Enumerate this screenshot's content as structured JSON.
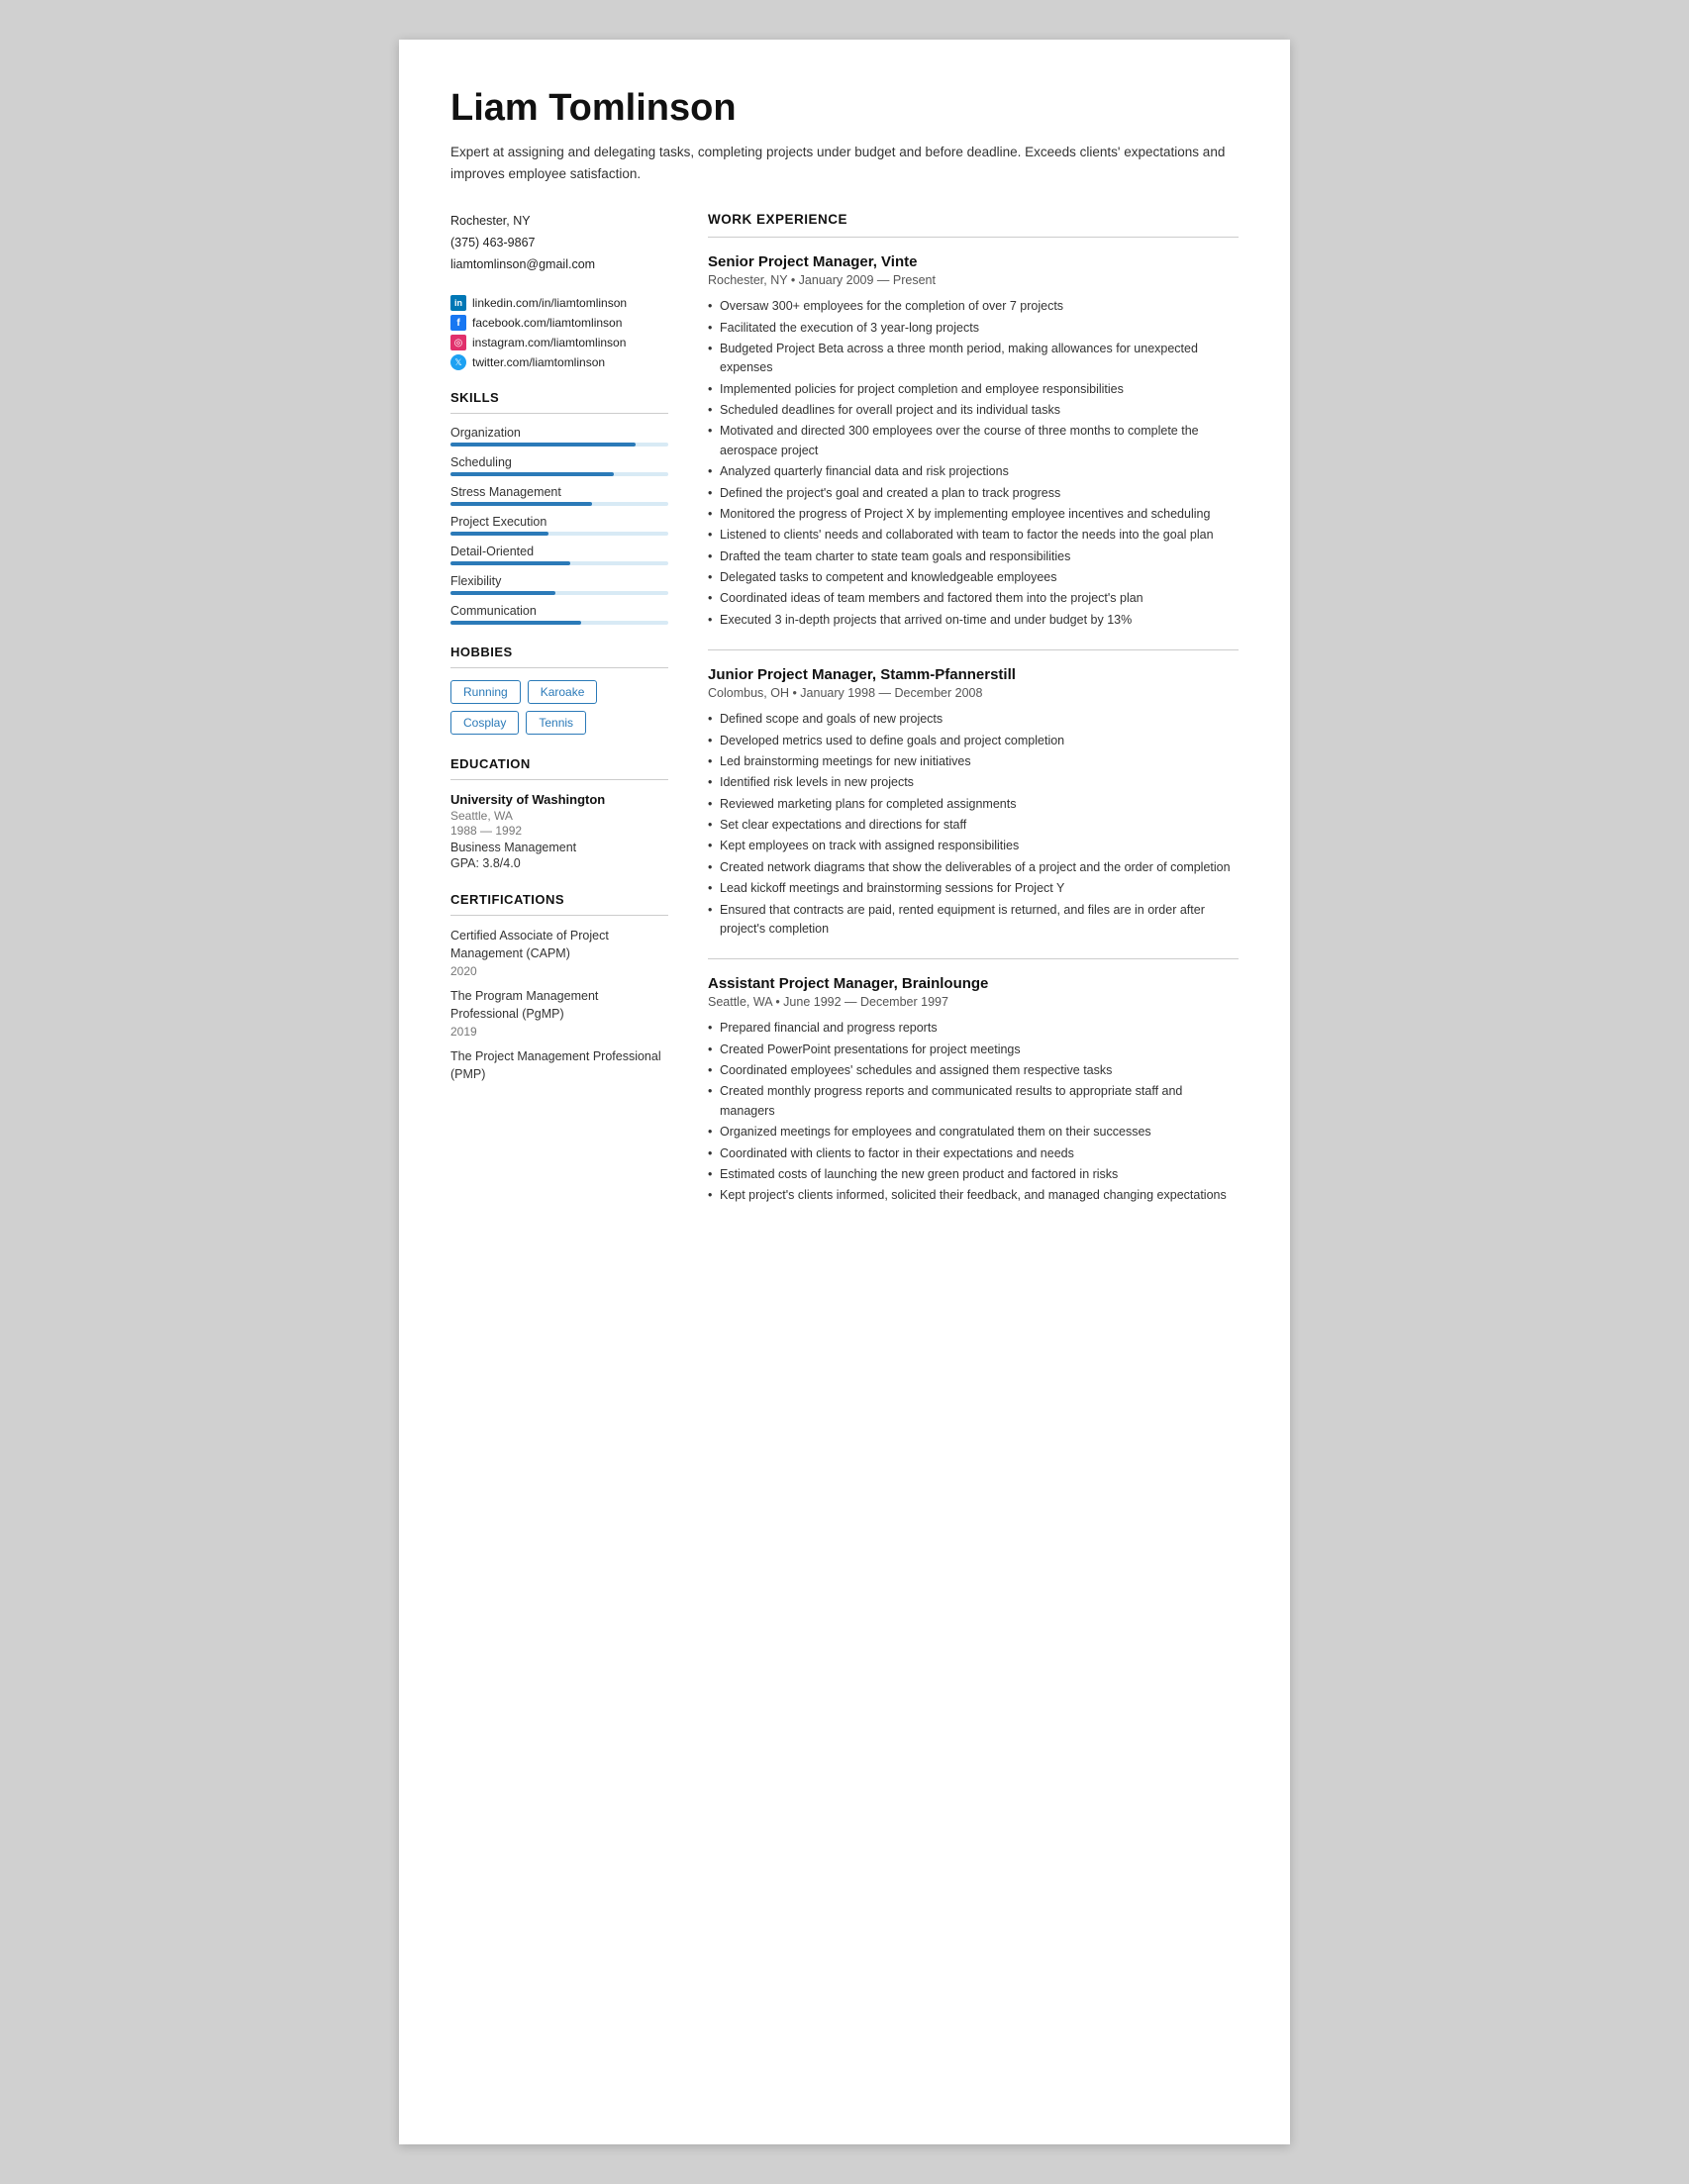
{
  "header": {
    "name": "Liam Tomlinson",
    "summary": "Expert at assigning and delegating tasks, completing projects under budget and before deadline. Exceeds clients' expectations and improves employee satisfaction."
  },
  "contact": {
    "location": "Rochester, NY",
    "phone": "(375) 463-9867",
    "email": "liamtomlinson@gmail.com",
    "linkedin": "linkedin.com/in/liamtomlinson",
    "facebook": "facebook.com/liamtomlinson",
    "instagram": "instagram.com/liamtomlinson",
    "twitter": "twitter.com/liamtomlinson"
  },
  "sections": {
    "skills_label": "SKILLS",
    "hobbies_label": "HOBBIES",
    "education_label": "EDUCATION",
    "certifications_label": "CERTIFICATIONS",
    "work_experience_label": "WORK EXPERIENCE"
  },
  "skills": [
    {
      "label": "Organization",
      "pct": 85
    },
    {
      "label": "Scheduling",
      "pct": 75
    },
    {
      "label": "Stress Management",
      "pct": 65
    },
    {
      "label": "Project Execution",
      "pct": 45
    },
    {
      "label": "Detail-Oriented",
      "pct": 55
    },
    {
      "label": "Flexibility",
      "pct": 48
    },
    {
      "label": "Communication",
      "pct": 60
    }
  ],
  "hobbies": [
    "Running",
    "Karoake",
    "Cosplay",
    "Tennis"
  ],
  "education": [
    {
      "school": "University of Washington",
      "location": "Seattle, WA",
      "years": "1988 — 1992",
      "field": "Business Management",
      "gpa": "GPA: 3.8/4.0"
    }
  ],
  "certifications": [
    {
      "name": "Certified Associate of Project Management (CAPM)",
      "year": "2020"
    },
    {
      "name": "The Program Management Professional (PgMP)",
      "year": "2019"
    },
    {
      "name": "The Project Management Professional (PMP)",
      "year": ""
    }
  ],
  "work_experience": [
    {
      "title": "Senior Project Manager, Vinte",
      "meta": "Rochester, NY • January 2009 — Present",
      "bullets": [
        "Oversaw 300+ employees for the completion of over 7 projects",
        "Facilitated the execution of 3 year-long projects",
        "Budgeted Project Beta across a three month period, making allowances for unexpected expenses",
        "Implemented policies for project completion and employee responsibilities",
        "Scheduled deadlines for overall project and its individual tasks",
        "Motivated and directed 300 employees over the course of three months to complete the aerospace project",
        "Analyzed quarterly financial data and risk projections",
        "Defined the project's goal and created a plan to track progress",
        "Monitored the progress of Project X by implementing employee incentives and scheduling",
        "Listened to clients' needs and collaborated with team to factor the needs into the goal plan",
        "Drafted the team charter to state team goals and responsibilities",
        "Delegated tasks to competent and knowledgeable employees",
        "Coordinated ideas of team members and factored them into the project's plan",
        "Executed 3 in-depth projects that arrived on-time and under budget by 13%"
      ]
    },
    {
      "title": "Junior Project Manager, Stamm-Pfannerstill",
      "meta": "Colombus, OH • January 1998 — December 2008",
      "bullets": [
        "Defined scope and goals of new projects",
        "Developed metrics used to define goals and project completion",
        "Led brainstorming meetings for new initiatives",
        "Identified risk levels in new projects",
        "Reviewed marketing plans for completed assignments",
        "Set clear expectations and directions for staff",
        "Kept employees on track with assigned responsibilities",
        "Created network diagrams that show the deliverables of a project and the order of completion",
        "Lead kickoff meetings and brainstorming sessions for Project Y",
        "Ensured that contracts are paid, rented equipment is returned, and files are in order after project's completion"
      ]
    },
    {
      "title": "Assistant Project Manager, Brainlounge",
      "meta": "Seattle, WA • June 1992 — December 1997",
      "bullets": [
        "Prepared financial and progress reports",
        "Created PowerPoint presentations for project meetings",
        "Coordinated employees' schedules and assigned them respective tasks",
        "Created monthly progress reports and communicated results to appropriate staff and managers",
        "Organized meetings for employees and congratulated them on their successes",
        "Coordinated with clients to factor in their expectations and needs",
        "Estimated costs of launching the new green product and factored in risks",
        "Kept project's clients informed, solicited their feedback, and managed changing expectations"
      ]
    }
  ]
}
